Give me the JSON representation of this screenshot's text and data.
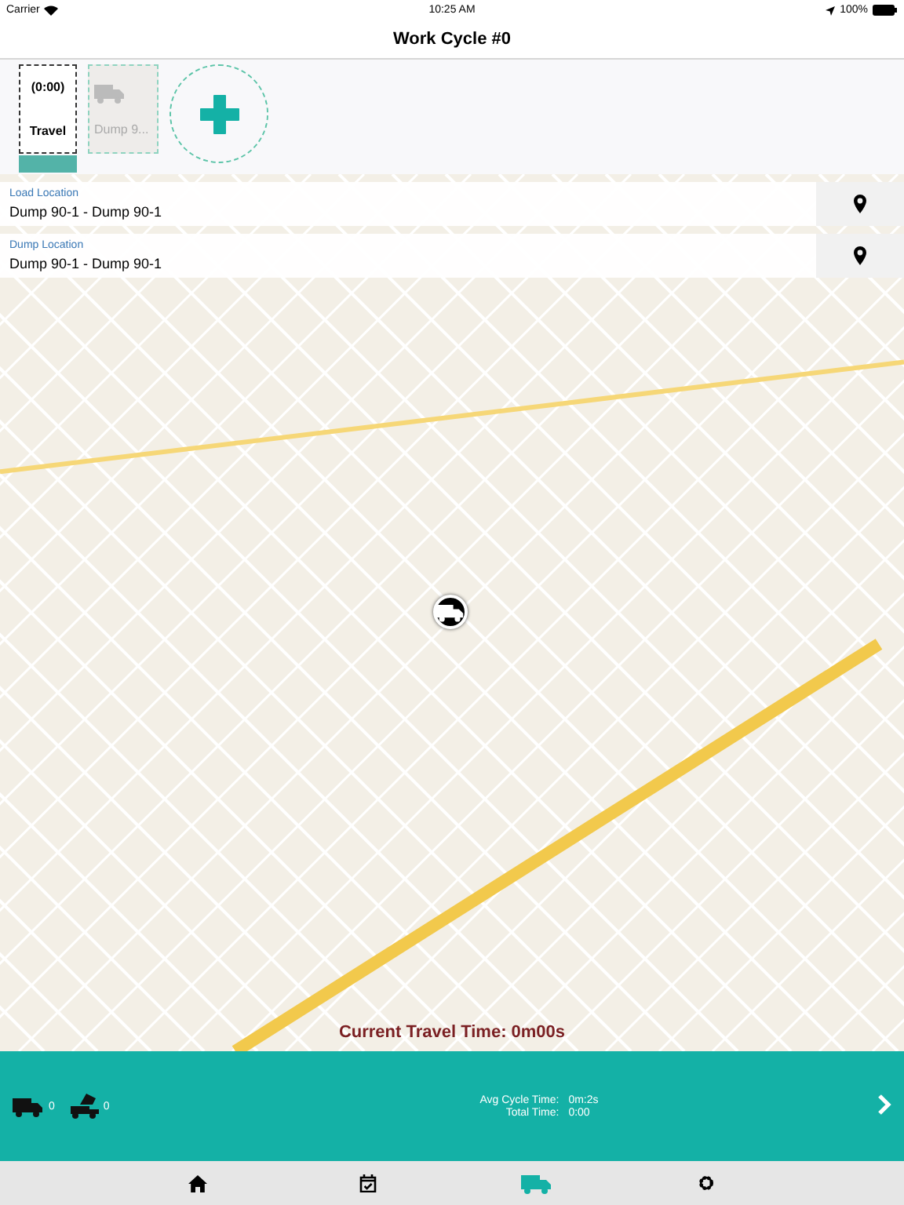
{
  "status_bar": {
    "carrier": "Carrier",
    "time": "10:25 AM",
    "battery": "100%"
  },
  "nav": {
    "title": "Work Cycle #0"
  },
  "activities": [
    {
      "time": "(0:00)",
      "label": "Travel",
      "selected": true
    },
    {
      "label": "Dump 9...",
      "selected": false
    }
  ],
  "locations": [
    {
      "label": "Load Location",
      "value": "Dump 90-1 - Dump 90-1"
    },
    {
      "label": "Dump Location",
      "value": "Dump 90-1 - Dump 90-1"
    }
  ],
  "current_travel_time": "Current Travel Time: 0m00s",
  "summary": {
    "load_count": "0",
    "dump_count": "0",
    "avg_label": "Avg Cycle Time:",
    "avg_value": "0m:2s",
    "total_label": "Total Time:",
    "total_value": "0:00"
  },
  "tabs": [
    {
      "kind": "home",
      "selected": false
    },
    {
      "kind": "calendar",
      "selected": false
    },
    {
      "kind": "truck",
      "selected": true
    },
    {
      "kind": "gear",
      "selected": false
    }
  ]
}
